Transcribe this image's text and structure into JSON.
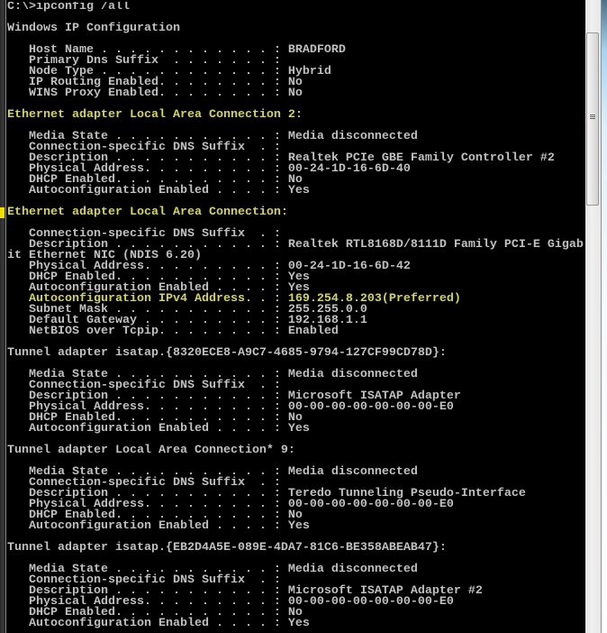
{
  "window": {
    "type": "command-prompt",
    "colors": {
      "background": "#000000",
      "text": "#c0c0c0",
      "highlight": "#d4d45a",
      "marker": "#f0e000"
    }
  },
  "console": {
    "command": "C:\\>ipconfig /all",
    "lines": [
      {
        "text": "C:\\>ipconfig /all",
        "hl": false
      },
      {
        "text": "",
        "hl": false
      },
      {
        "text": "Windows IP Configuration",
        "hl": false
      },
      {
        "text": "",
        "hl": false
      },
      {
        "text": "   Host Name . . . . . . . . . . . . : BRADFORD",
        "hl": false
      },
      {
        "text": "   Primary Dns Suffix  . . . . . . . :",
        "hl": false
      },
      {
        "text": "   Node Type . . . . . . . . . . . . : Hybrid",
        "hl": false
      },
      {
        "text": "   IP Routing Enabled. . . . . . . . : No",
        "hl": false
      },
      {
        "text": "   WINS Proxy Enabled. . . . . . . . : No",
        "hl": false
      },
      {
        "text": "",
        "hl": false
      },
      {
        "text": "Ethernet adapter Local Area Connection 2:",
        "hl": true
      },
      {
        "text": "",
        "hl": false
      },
      {
        "text": "   Media State . . . . . . . . . . . : Media disconnected",
        "hl": false
      },
      {
        "text": "   Connection-specific DNS Suffix  . :",
        "hl": false
      },
      {
        "text": "   Description . . . . . . . . . . . : Realtek PCIe GBE Family Controller #2",
        "hl": false
      },
      {
        "text": "   Physical Address. . . . . . . . . : 00-24-1D-16-6D-40",
        "hl": false
      },
      {
        "text": "   DHCP Enabled. . . . . . . . . . . : No",
        "hl": false
      },
      {
        "text": "   Autoconfiguration Enabled . . . . : Yes",
        "hl": false
      },
      {
        "text": "",
        "hl": false
      },
      {
        "text": "Ethernet adapter Local Area Connection:",
        "hl": true
      },
      {
        "text": "",
        "hl": false
      },
      {
        "text": "   Connection-specific DNS Suffix  . :",
        "hl": false
      },
      {
        "text": "   Description . . . . . . . . . . . : Realtek RTL8168D/8111D Family PCI-E Gigab",
        "hl": false
      },
      {
        "text": "it Ethernet NIC (NDIS 6.20)",
        "hl": false
      },
      {
        "text": "   Physical Address. . . . . . . . . : 00-24-1D-16-6D-42",
        "hl": false
      },
      {
        "text": "   DHCP Enabled. . . . . . . . . . . : Yes",
        "hl": false
      },
      {
        "text": "   Autoconfiguration Enabled . . . . : Yes",
        "hl": false
      },
      {
        "text": "   Autoconfiguration IPv4 Address. . : 169.254.8.203(Preferred)",
        "hl": true
      },
      {
        "text": "   Subnet Mask . . . . . . . . . . . : 255.255.0.0",
        "hl": false
      },
      {
        "text": "   Default Gateway . . . . . . . . . : 192.168.1.1",
        "hl": false
      },
      {
        "text": "   NetBIOS over Tcpip. . . . . . . . : Enabled",
        "hl": false
      },
      {
        "text": "",
        "hl": false
      },
      {
        "text": "Tunnel adapter isatap.{8320ECE8-A9C7-4685-9794-127CF99CD78D}:",
        "hl": false
      },
      {
        "text": "",
        "hl": false
      },
      {
        "text": "   Media State . . . . . . . . . . . : Media disconnected",
        "hl": false
      },
      {
        "text": "   Connection-specific DNS Suffix  . :",
        "hl": false
      },
      {
        "text": "   Description . . . . . . . . . . . : Microsoft ISATAP Adapter",
        "hl": false
      },
      {
        "text": "   Physical Address. . . . . . . . . : 00-00-00-00-00-00-00-E0",
        "hl": false
      },
      {
        "text": "   DHCP Enabled. . . . . . . . . . . : No",
        "hl": false
      },
      {
        "text": "   Autoconfiguration Enabled . . . . : Yes",
        "hl": false
      },
      {
        "text": "",
        "hl": false
      },
      {
        "text": "Tunnel adapter Local Area Connection* 9:",
        "hl": false
      },
      {
        "text": "",
        "hl": false
      },
      {
        "text": "   Media State . . . . . . . . . . . : Media disconnected",
        "hl": false
      },
      {
        "text": "   Connection-specific DNS Suffix  . :",
        "hl": false
      },
      {
        "text": "   Description . . . . . . . . . . . : Teredo Tunneling Pseudo-Interface",
        "hl": false
      },
      {
        "text": "   Physical Address. . . . . . . . . : 00-00-00-00-00-00-00-E0",
        "hl": false
      },
      {
        "text": "   DHCP Enabled. . . . . . . . . . . : No",
        "hl": false
      },
      {
        "text": "   Autoconfiguration Enabled . . . . : Yes",
        "hl": false
      },
      {
        "text": "",
        "hl": false
      },
      {
        "text": "Tunnel adapter isatap.{EB2D4A5E-089E-4DA7-81C6-BE358ABEAB47}:",
        "hl": false
      },
      {
        "text": "",
        "hl": false
      },
      {
        "text": "   Media State . . . . . . . . . . . : Media disconnected",
        "hl": false
      },
      {
        "text": "   Connection-specific DNS Suffix  . :",
        "hl": false
      },
      {
        "text": "   Description . . . . . . . . . . . : Microsoft ISATAP Adapter #2",
        "hl": false
      },
      {
        "text": "   Physical Address. . . . . . . . . : 00-00-00-00-00-00-00-E0",
        "hl": false
      },
      {
        "text": "   DHCP Enabled. . . . . . . . . . . : No",
        "hl": false
      },
      {
        "text": "   Autoconfiguration Enabled . . . . : Yes",
        "hl": false
      }
    ]
  },
  "scrollbar": {
    "position_fraction": 0.0,
    "visible_fraction": 0.28,
    "grip_icon": "grip-lines-icon"
  }
}
